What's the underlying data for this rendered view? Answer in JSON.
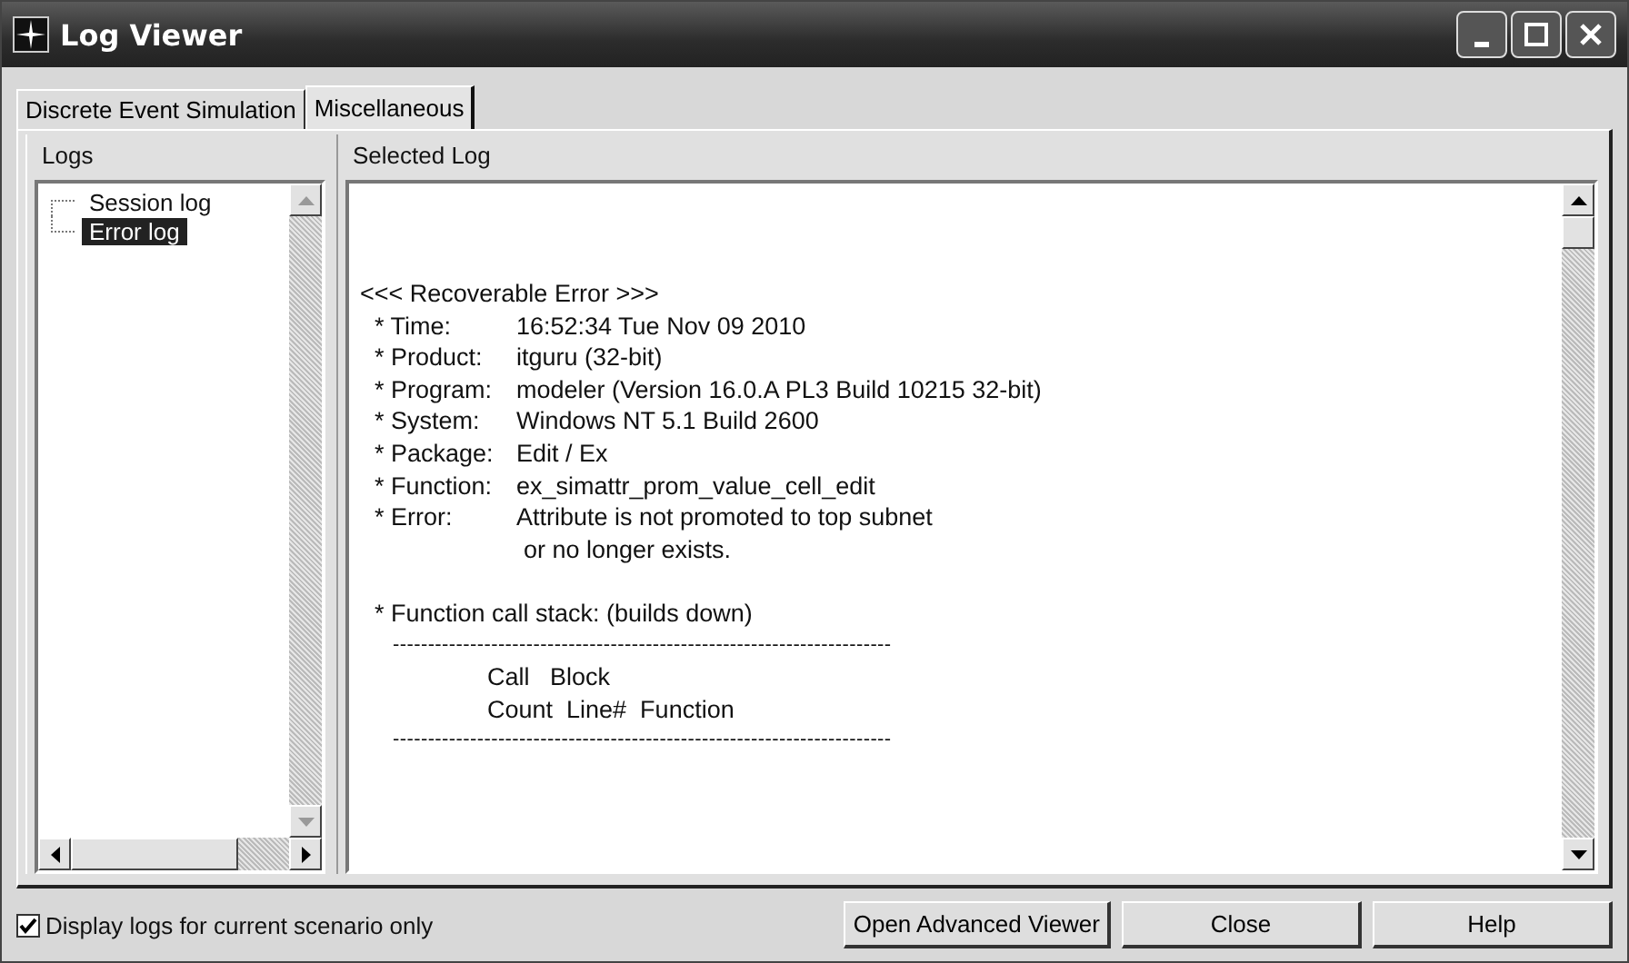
{
  "window": {
    "title": "Log Viewer"
  },
  "tabs": [
    {
      "label": "Discrete Event Simulation",
      "selected": false
    },
    {
      "label": "Miscellaneous",
      "selected": true
    }
  ],
  "logs": {
    "title": "Logs",
    "items": [
      {
        "label": "Session log",
        "selected": false
      },
      {
        "label": "Error log",
        "selected": true
      }
    ]
  },
  "selected_log": {
    "title": "Selected Log",
    "lines": [
      {
        "kind": "heading",
        "text": "<<< Recoverable Error >>>"
      },
      {
        "kind": "field",
        "label": "* Time:",
        "value": "16:52:34 Tue Nov 09 2010"
      },
      {
        "kind": "field",
        "label": "* Product:",
        "value": "itguru (32-bit)"
      },
      {
        "kind": "field",
        "label": "* Program:",
        "value": "modeler (Version 16.0.A PL3 Build 10215 32-bit)"
      },
      {
        "kind": "field",
        "label": "* System:",
        "value": "Windows NT 5.1 Build 2600"
      },
      {
        "kind": "field",
        "label": "* Package:",
        "value": "Edit / Ex"
      },
      {
        "kind": "field",
        "label": "* Function:",
        "value": "ex_simattr_prom_value_cell_edit"
      },
      {
        "kind": "field",
        "label": "* Error:",
        "value": "Attribute is not promoted to top subnet"
      },
      {
        "kind": "continuation",
        "text": "or no longer exists."
      },
      {
        "kind": "spacer"
      },
      {
        "kind": "text",
        "text": "* Function call stack: (builds down)"
      },
      {
        "kind": "rule",
        "text": "-----------------------------------------------------------------------"
      },
      {
        "kind": "indented",
        "text": "Call   Block"
      },
      {
        "kind": "indented",
        "text": "Count  Line#  Function"
      },
      {
        "kind": "rule",
        "text": "-----------------------------------------------------------------------"
      }
    ]
  },
  "checkbox": {
    "label": "Display logs for current scenario only",
    "checked": true
  },
  "buttons": [
    "Open Advanced Viewer",
    "Close",
    "Help"
  ]
}
